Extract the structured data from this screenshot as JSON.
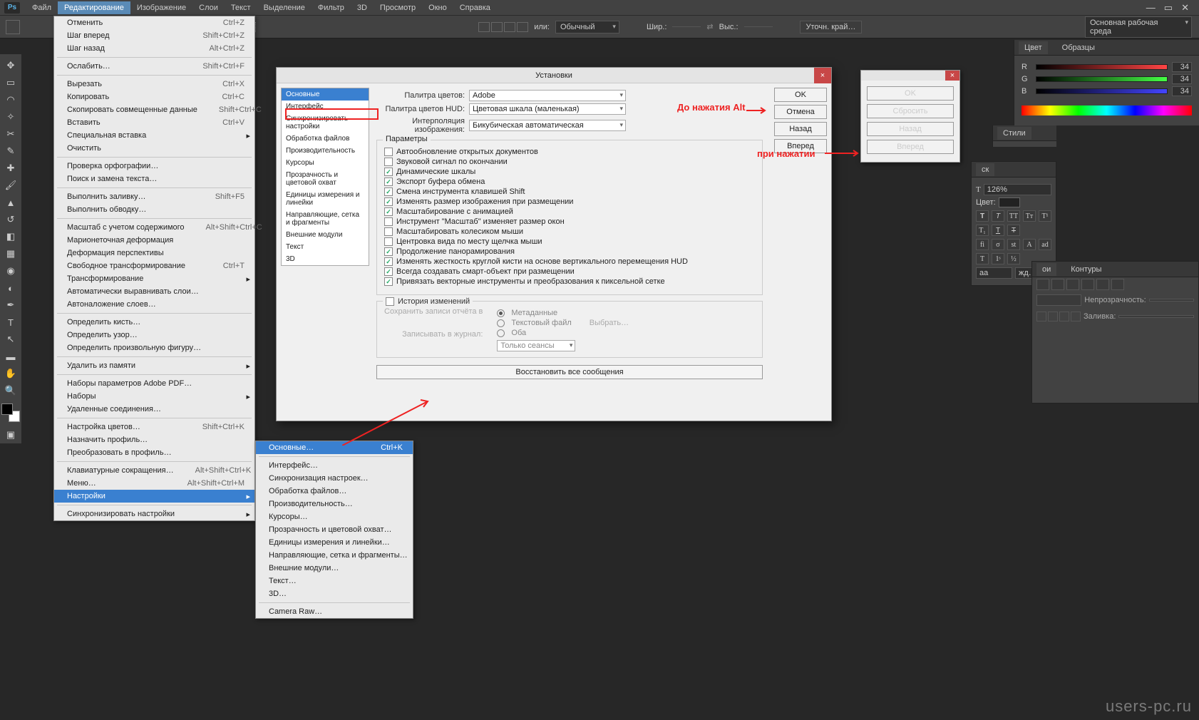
{
  "menubar": {
    "items": [
      "Файл",
      "Редактирование",
      "Изображение",
      "Слои",
      "Текст",
      "Выделение",
      "Фильтр",
      "3D",
      "Просмотр",
      "Окно",
      "Справка"
    ],
    "active": 1
  },
  "optionbar": {
    "style_lbl": "или:",
    "style_val": "Обычный",
    "w_lbl": "Шир.:",
    "h_lbl": "Выс.:",
    "refine": "Уточн. край…",
    "workspace": "Основная рабочая среда"
  },
  "edit_menu": [
    {
      "t": "Отменить",
      "s": "Ctrl+Z"
    },
    {
      "t": "Шаг вперед",
      "s": "Shift+Ctrl+Z"
    },
    {
      "t": "Шаг назад",
      "s": "Alt+Ctrl+Z"
    },
    {
      "sep": true
    },
    {
      "t": "Ослабить…",
      "s": "Shift+Ctrl+F"
    },
    {
      "sep": true
    },
    {
      "t": "Вырезать",
      "s": "Ctrl+X"
    },
    {
      "t": "Копировать",
      "s": "Ctrl+C"
    },
    {
      "t": "Скопировать совмещенные данные",
      "s": "Shift+Ctrl+C"
    },
    {
      "t": "Вставить",
      "s": "Ctrl+V"
    },
    {
      "t": "Специальная вставка",
      "sub": true
    },
    {
      "t": "Очистить"
    },
    {
      "sep": true
    },
    {
      "t": "Проверка орфографии…"
    },
    {
      "t": "Поиск и замена текста…"
    },
    {
      "sep": true
    },
    {
      "t": "Выполнить заливку…",
      "s": "Shift+F5"
    },
    {
      "t": "Выполнить обводку…"
    },
    {
      "sep": true
    },
    {
      "t": "Масштаб с учетом содержимого",
      "s": "Alt+Shift+Ctrl+C"
    },
    {
      "t": "Марионеточная деформация"
    },
    {
      "t": "Деформация перспективы"
    },
    {
      "t": "Свободное трансформирование",
      "s": "Ctrl+T"
    },
    {
      "t": "Трансформирование",
      "sub": true
    },
    {
      "t": "Автоматически выравнивать слои…"
    },
    {
      "t": "Автоналожение слоев…"
    },
    {
      "sep": true
    },
    {
      "t": "Определить кисть…"
    },
    {
      "t": "Определить узор…"
    },
    {
      "t": "Определить произвольную фигуру…"
    },
    {
      "sep": true
    },
    {
      "t": "Удалить из памяти",
      "sub": true
    },
    {
      "sep": true
    },
    {
      "t": "Наборы параметров Adobe PDF…"
    },
    {
      "t": "Наборы",
      "sub": true
    },
    {
      "t": "Удаленные соединения…"
    },
    {
      "sep": true
    },
    {
      "t": "Настройка цветов…",
      "s": "Shift+Ctrl+K"
    },
    {
      "t": "Назначить профиль…"
    },
    {
      "t": "Преобразовать в профиль…"
    },
    {
      "sep": true
    },
    {
      "t": "Клавиатурные сокращения…",
      "s": "Alt+Shift+Ctrl+K"
    },
    {
      "t": "Меню…",
      "s": "Alt+Shift+Ctrl+M"
    },
    {
      "t": "Настройки",
      "sub": true,
      "sel": true
    },
    {
      "sep": true
    },
    {
      "t": "Синхронизировать настройки",
      "sub": true
    }
  ],
  "prefs_submenu": [
    {
      "t": "Основные…",
      "s": "Ctrl+K",
      "sel": true
    },
    {
      "sep": true
    },
    {
      "t": "Интерфейс…"
    },
    {
      "t": "Синхронизация настроек…"
    },
    {
      "t": "Обработка файлов…"
    },
    {
      "t": "Производительность…"
    },
    {
      "t": "Курсоры…"
    },
    {
      "t": "Прозрачность и цветовой охват…"
    },
    {
      "t": "Единицы измерения и линейки…"
    },
    {
      "t": "Направляющие, сетка и фрагменты…"
    },
    {
      "t": "Внешние модули…"
    },
    {
      "t": "Текст…"
    },
    {
      "t": "3D…"
    },
    {
      "sep": true
    },
    {
      "t": "Camera Raw…"
    }
  ],
  "dialog": {
    "title": "Установки",
    "cats": [
      "Основные",
      "Интерфейс",
      "Синхронизировать настройки",
      "Обработка файлов",
      "Производительность",
      "Курсоры",
      "Прозрачность и цветовой охват",
      "Единицы измерения и линейки",
      "Направляющие, сетка и фрагменты",
      "Внешние модули",
      "Текст",
      "3D"
    ],
    "lbl_picker": "Палитра цветов:",
    "val_picker": "Adobe",
    "lbl_hud": "Палитра цветов HUD:",
    "val_hud": "Цветовая шкала (маленькая)",
    "lbl_interp": "Интерполяция изображения:",
    "val_interp": "Бикубическая автоматическая",
    "legend": "Параметры",
    "checks": [
      {
        "t": "Автообновление открытых документов",
        "on": false
      },
      {
        "t": "Звуковой сигнал по окончании",
        "on": false
      },
      {
        "t": "Динамические шкалы",
        "on": true
      },
      {
        "t": "Экспорт буфера обмена",
        "on": true
      },
      {
        "t": "Смена инструмента клавишей Shift",
        "on": true
      },
      {
        "t": "Изменять размер изображения при размещении",
        "on": true
      },
      {
        "t": "Масштабирование с анимацией",
        "on": true
      },
      {
        "t": "Инструмент \"Масштаб\" изменяет размер окон",
        "on": false
      },
      {
        "t": "Масштабировать колесиком мыши",
        "on": false
      },
      {
        "t": "Центровка вида по месту щелчка мыши",
        "on": false
      },
      {
        "t": "Продолжение панорамирования",
        "on": true
      },
      {
        "t": "Изменять жесткость круглой кисти на основе вертикального перемещения HUD",
        "on": true
      },
      {
        "t": "Всегда создавать смарт-объект при размещении",
        "on": true
      },
      {
        "t": "Привязать векторные инструменты и преобразования к пиксельной сетке",
        "on": true
      }
    ],
    "history_title": "История изменений",
    "save_lbl": "Сохранить записи отчёта в",
    "r_meta": "Метаданные",
    "r_txt": "Текстовый файл",
    "r_both": "Оба",
    "choose": "Выбрать…",
    "write_lbl": "Записывать в журнал:",
    "write_val": "Только сеансы",
    "restore": "Восстановить все сообщения",
    "btns": {
      "ok": "OK",
      "cancel": "Отмена",
      "back": "Назад",
      "fwd": "Вперед"
    }
  },
  "alt_panel": {
    "ok": "OK",
    "reset": "Сбросить",
    "back": "Назад",
    "fwd": "Вперед"
  },
  "anno": {
    "before": "До нажатия Alt",
    "after": "при нажатии"
  },
  "color_panel": {
    "tab1": "Цвет",
    "tab2": "Образцы",
    "r": "R",
    "g": "G",
    "b": "B",
    "val": "34"
  },
  "styles_tab": "Стили",
  "char": {
    "tab1": "ск",
    "zoom": "126%",
    "color_lbl": "Цвет:",
    "lang": "жд…",
    "aa": "aa"
  },
  "layers": {
    "tab1": "ои",
    "tab2": "Контуры",
    "opacity_lbl": "Непрозрачность:",
    "fill_lbl": "Заливка:"
  },
  "watermark": "users-pc.ru"
}
